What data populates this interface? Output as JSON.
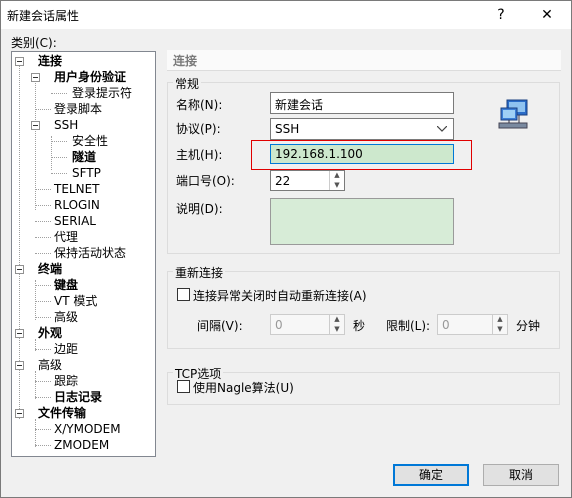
{
  "window": {
    "title": "新建会话属性",
    "help_glyph": "?",
    "close_glyph": "✕"
  },
  "category_label": "类别(C):",
  "tree": {
    "lianjie": "连接",
    "yonghu": "用户身份验证",
    "denglu_tishi": "登录提示符",
    "denglu_jiaoben": "登录脚本",
    "ssh": "SSH",
    "anquanxing": "安全性",
    "suidao": "隧道",
    "sftp": "SFTP",
    "telnet": "TELNET",
    "rlogin": "RLOGIN",
    "serial": "SERIAL",
    "daili": "代理",
    "baochi": "保持活动状态",
    "zhongduan": "终端",
    "jianpan": "键盘",
    "vt": "VT 模式",
    "gaoji1": "高级",
    "waiguan": "外观",
    "bianju": "边距",
    "gaoji2": "高级",
    "genzong": "跟踪",
    "rizhi": "日志记录",
    "wenjian": "文件传输",
    "xymodem": "X/YMODEM",
    "zmodem": "ZMODEM"
  },
  "panel": {
    "header": "连接",
    "general": {
      "legend": "常规",
      "name_label": "名称(N):",
      "name_value": "新建会话",
      "protocol_label": "协议(P):",
      "protocol_value": "SSH",
      "host_label": "主机(H):",
      "host_value": "192.168.1.100",
      "port_label": "端口号(O):",
      "port_value": "22",
      "desc_label": "说明(D):",
      "desc_value": ""
    },
    "reconnect": {
      "legend": "重新连接",
      "checkbox_label": "连接异常关闭时自动重新连接(A)",
      "interval_label": "间隔(V):",
      "interval_value": "0",
      "seconds": "秒",
      "limit_label": "限制(L):",
      "limit_value": "0",
      "minutes": "分钟"
    },
    "tcp": {
      "legend": "TCP选项",
      "nagle_label": "使用Nagle算法(U)"
    }
  },
  "buttons": {
    "ok": "确定",
    "cancel": "取消"
  },
  "colors": {
    "host_highlight": "#cde8cd",
    "desc_bg": "#d7ecd7",
    "highlight_border": "#e00000",
    "default_button": "#0078d7"
  }
}
